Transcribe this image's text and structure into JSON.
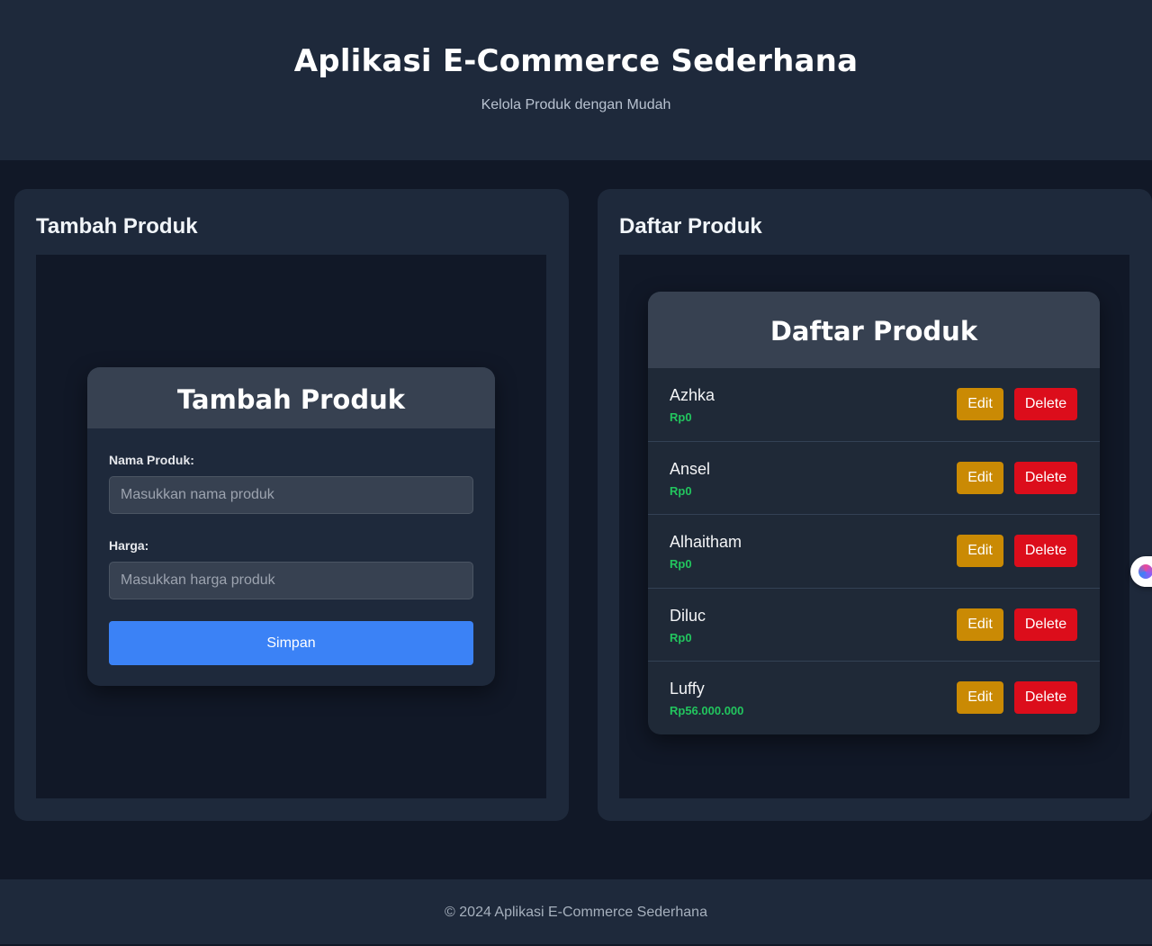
{
  "header": {
    "title": "Aplikasi E-Commerce Sederhana",
    "subtitle": "Kelola Produk dengan Mudah"
  },
  "add_panel": {
    "title": "Tambah Produk",
    "card_title": "Tambah Produk",
    "name_label": "Nama Produk:",
    "name_placeholder": "Masukkan nama produk",
    "name_value": "",
    "price_label": "Harga:",
    "price_placeholder": "Masukkan harga produk",
    "price_value": "",
    "save_label": "Simpan"
  },
  "list_panel": {
    "title": "Daftar Produk",
    "card_title": "Daftar Produk",
    "edit_label": "Edit",
    "delete_label": "Delete",
    "products": [
      {
        "name": "Azhka",
        "price": "Rp0"
      },
      {
        "name": "Ansel",
        "price": "Rp0"
      },
      {
        "name": "Alhaitham",
        "price": "Rp0"
      },
      {
        "name": "Diluc",
        "price": "Rp0"
      },
      {
        "name": "Luffy",
        "price": "Rp56.000.000"
      }
    ]
  },
  "footer": {
    "text": "© 2024 Aplikasi E-Commerce Sederhana"
  },
  "floating_widget": {
    "icon": "brain-icon"
  },
  "colors": {
    "primary": "#3b82f6",
    "edit": "#ca8a04",
    "delete": "#dc0d1b",
    "price": "#22c55e",
    "background": "#111827",
    "surface": "#1e293b"
  }
}
